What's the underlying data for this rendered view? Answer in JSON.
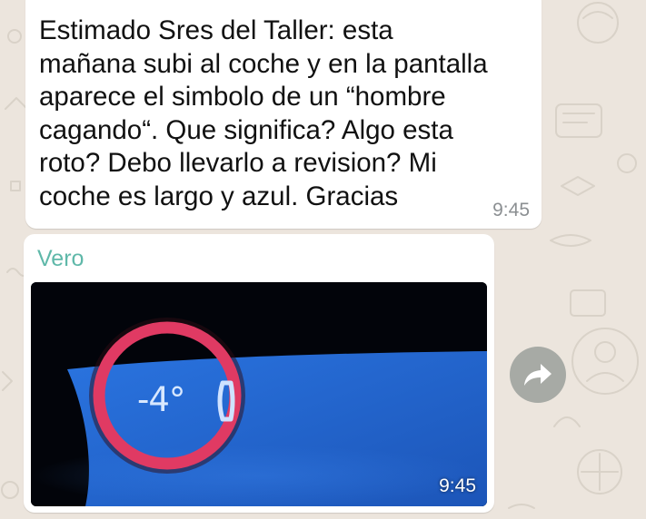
{
  "chat": {
    "messages": [
      {
        "text": "Estimado Sres del Taller: esta\nmañana subi al coche y en la pantalla\naparece el simbolo de un “hombre\ncagando“. Que significa? Algo esta\nroto? Debo llevarlo a revision? Mi\ncoche es largo y azul. Gracias",
        "time": "9:45"
      },
      {
        "sender": "Vero",
        "photo": {
          "display_reading": "-4°"
        },
        "time": "9:45"
      }
    ],
    "forward_icon": "forward-arrow-icon"
  },
  "colors": {
    "wallpaper": "#ece5dd",
    "bubble": "#ffffff",
    "sender_name": "#5fb8a9",
    "timestamp": "#8b8f92",
    "forward_button": "#a7aaa5",
    "photo_ring": "#e03a63",
    "photo_screen": "#2a6fd8"
  }
}
